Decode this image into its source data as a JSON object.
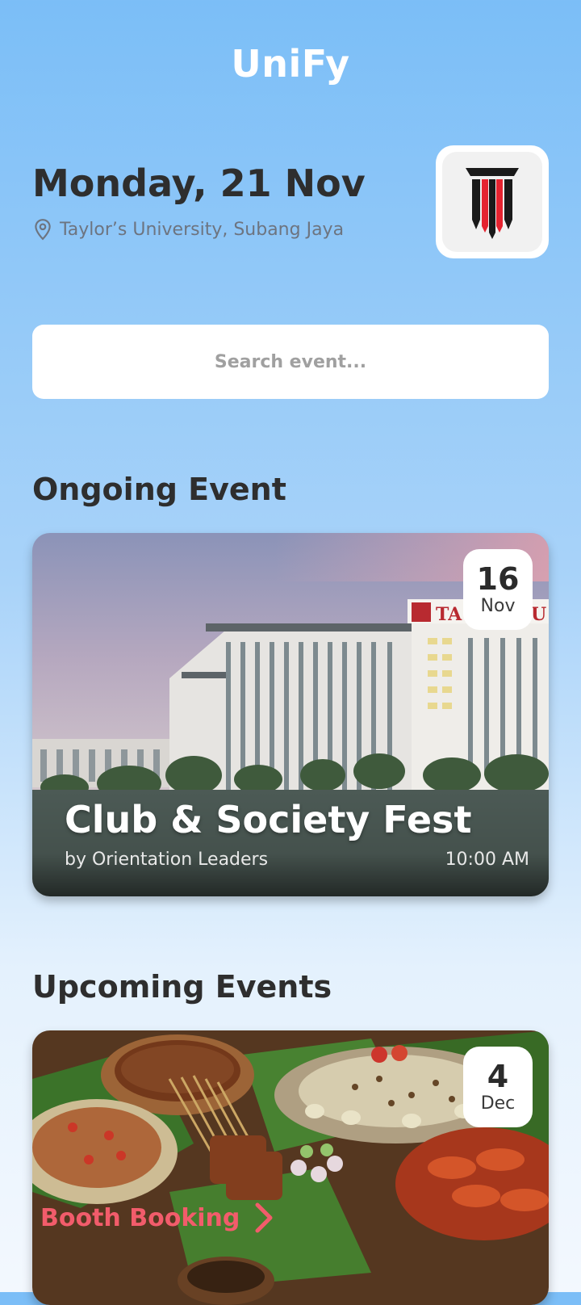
{
  "app": {
    "title": "UniFy"
  },
  "header": {
    "date": "Monday, 21 Nov",
    "location": "Taylor’s University, Subang Jaya",
    "icons": {
      "location": "map-pin-icon",
      "logo": "university-logo"
    },
    "logo_colors": {
      "black": "#1a1a1a",
      "red": "#e52330"
    }
  },
  "search": {
    "placeholder": "Search event..."
  },
  "ongoing": {
    "section_title": "Ongoing Event",
    "event": {
      "day": "16",
      "month": "Nov",
      "title": "Club & Society Fest",
      "organizer": "by Orientation Leaders",
      "time": "10:00 AM"
    }
  },
  "upcoming": {
    "section_title": "Upcoming Events",
    "event": {
      "day": "4",
      "month": "Dec",
      "title": "Booth Booking",
      "icon": "chevron-right-icon",
      "accent_color": "#f25c6b"
    }
  }
}
